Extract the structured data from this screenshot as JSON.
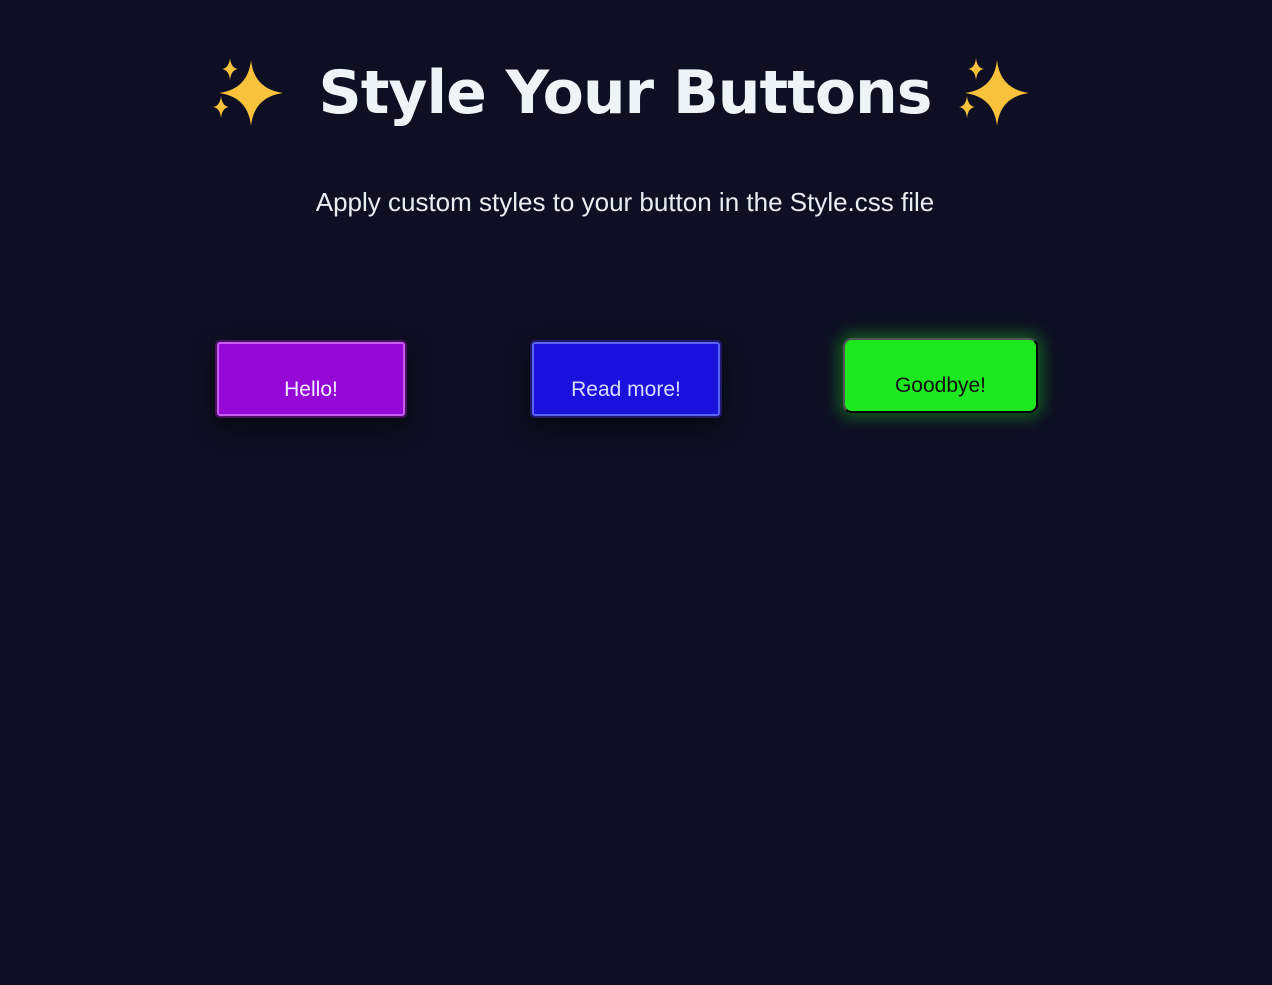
{
  "header": {
    "title": "Style Your Buttons",
    "icon_left": "sparkles-icon",
    "icon_right": "sparkles-icon"
  },
  "subtitle": "Apply custom styles to your button in the Style.css file",
  "buttons": [
    {
      "label": "Hello!",
      "color": "#9409d6"
    },
    {
      "label": "Read more!",
      "color": "#1a12dc"
    },
    {
      "label": "Goodbye!",
      "color": "#1de81f"
    }
  ],
  "colors": {
    "background": "#0e0f22",
    "sparkle": "#f9c23c"
  }
}
